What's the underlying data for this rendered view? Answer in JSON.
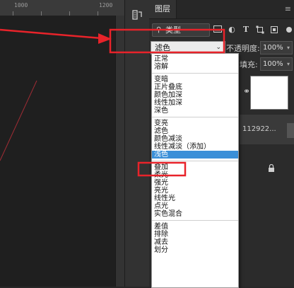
{
  "ruler": {
    "mark": "1000",
    "mark2": "1200"
  },
  "panel": {
    "tab_label": "图层",
    "menu_icon": "menu-icon",
    "filter": {
      "kind_label": "类型",
      "icons": [
        "image-filter-icon",
        "adjustment-filter-icon",
        "text-filter-icon",
        "shape-filter-icon",
        "smart-object-filter-icon"
      ]
    },
    "blend_mode": {
      "value": "滤色"
    },
    "opacity": {
      "label": "不透明度:",
      "value": "100%"
    },
    "fill": {
      "label": "填充:",
      "value": "100%"
    },
    "layer_name": "112922..."
  },
  "dropdown": {
    "groups": [
      [
        "正常",
        "溶解"
      ],
      [
        "变暗",
        "正片叠底",
        "颜色加深",
        "线性加深",
        "深色"
      ],
      [
        "变亮",
        "滤色",
        "颜色减淡",
        "线性减淡（添加）",
        "浅色"
      ],
      [
        "叠加",
        "柔光",
        "强光",
        "亮光",
        "线性光",
        "点光",
        "实色混合"
      ],
      [
        "差值",
        "排除",
        "减去",
        "划分"
      ]
    ],
    "selected": "浅色"
  },
  "colors": {
    "annotation": "#e8232a",
    "selection": "#3a8fd8",
    "panel_bg": "#2b2b2b",
    "canvas_bg": "#1f1f1f"
  }
}
